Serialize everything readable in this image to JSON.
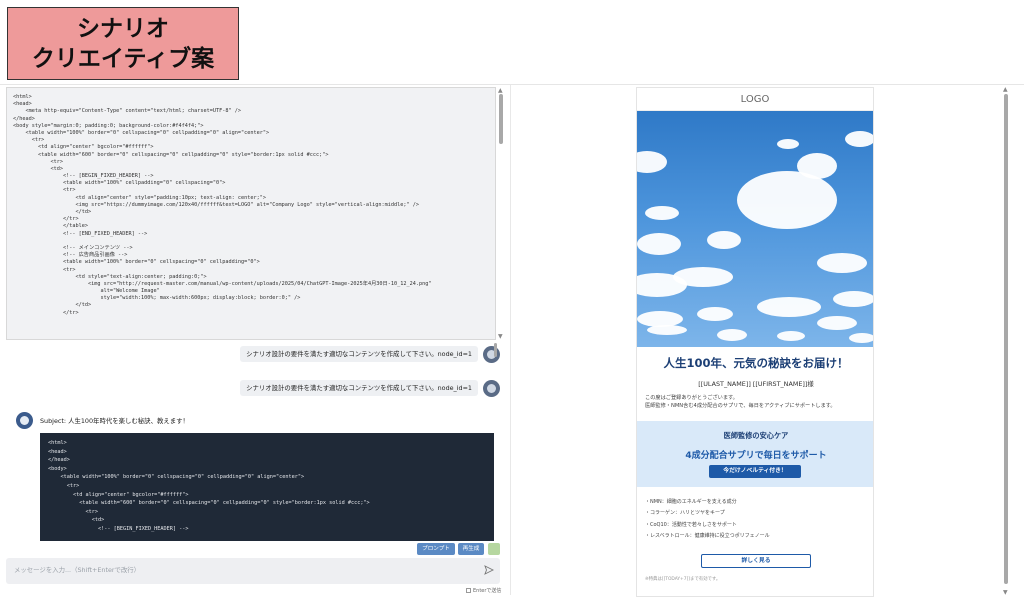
{
  "title_badge": {
    "line1": "シナリオ",
    "line2": "クリエイティブ案"
  },
  "code_viewer": {
    "lines": [
      "<html>",
      "<head>",
      "    <meta http-equiv=\"Content-Type\" content=\"text/html; charset=UTF-8\" />",
      "</head>",
      "<body style=\"margin:0; padding:0; background-color:#f4f4f4;\">",
      "    <table width=\"100%\" border=\"0\" cellspacing=\"0\" cellpadding=\"0\" align=\"center\">",
      "      <tr>",
      "        <td align=\"center\" bgcolor=\"#ffffff\">",
      "        <table width=\"600\" border=\"0\" cellspacing=\"0\" cellpadding=\"0\" style=\"border:1px solid #ccc;\">",
      "            <tr>",
      "            <td>",
      "                <!-- [BEGIN_FIXED_HEADER] -->",
      "                <table width=\"100%\" cellpadding=\"0\" cellspacing=\"0\">",
      "                <tr>",
      "                    <td align=\"center\" style=\"padding:10px; text-align: center;\">",
      "                    <img src=\"https://dummyimage.com/120x40/ffffff&text=LOGO\" alt=\"Company Logo\" style=\"vertical-align:middle;\" />",
      "                    </td>",
      "                </tr>",
      "                </table>",
      "                <!-- [END_FIXED_HEADER] -->",
      "",
      "                <!-- メインコンテンツ -->",
      "                <!-- 広告商品引画像 -->",
      "                <table width=\"100%\" border=\"0\" cellspacing=\"0\" cellpadding=\"0\">",
      "                <tr>",
      "                    <td style=\"text-align:center; padding:0;\">",
      "                        <img src=\"http://request-master.com/manual/wp-content/uploads/2025/04/ChatGPT-Image-2025年4月30日-10_12_24.png\"",
      "                            alt=\"Welcome Image\"",
      "                            style=\"width:100%; max-width:600px; display:block; border:0;\" />",
      "                    </td>",
      "                </tr>"
    ]
  },
  "chat": {
    "user_message_1": "シナリオ設計の要件を満たす適切なコンテンツを作成して下さい。node_id=1",
    "user_message_2": "シナリオ設計の要件を満たす適切なコンテンツを作成して下さい。node_id=1",
    "bot_subject": "Subject: 人生100年時代を楽しむ秘訣、教えます！",
    "bot_code_lines": [
      "<html>",
      "<head>",
      "</head>",
      "<body>",
      "    <table width=\"100%\" border=\"0\" cellspacing=\"0\" cellpadding=\"0\" align=\"center\">",
      "      <tr>",
      "        <td align=\"center\" bgcolor=\"#ffffff\">",
      "          <table width=\"600\" border=\"0\" cellspacing=\"0\" cellpadding=\"0\" style=\"border:1px solid #ccc;\">",
      "            <tr>",
      "              <td>",
      "                <!-- [BEGIN_FIXED_HEADER] -->"
    ],
    "prompt_button": "プロンプト",
    "regenerate_button": "再生成",
    "input_placeholder": "メッセージを入力...（Shift+Enterで改行）",
    "enter_toggle_label": "Enterで送信"
  },
  "email": {
    "logo": "LOGO",
    "headline": "人生100年、元気の秘訣をお届け！",
    "merge_fields": "[[ULAST_NAME]] [[UFIRST_NAME]]様",
    "intro_line1": "この度はご登録ありがとうございます。",
    "intro_line2": "医師監修・NMN含む4成分配合のサプリで、毎日をアクティブにサポートします。",
    "care_title": "医師監修の安心ケア",
    "care_sub": "4成分配合サプリで毎日をサポート",
    "care_button": "今だけノベルティ付き！",
    "features": [
      "・NMN：細胞のエネルギーを支える成分",
      "・コラーゲン：ハリとツヤをキープ",
      "・CoQ10：活動性で若々しさをサポート",
      "・レスベラトロール：健康維持に役立つポリフェノール"
    ],
    "more_button": "詳しく見る",
    "footnote": "※特典は[[TODAY+7]]まで有効です。"
  },
  "colors": {
    "title_badge_bg": "#ee9a9a",
    "accent_blue": "#1e5aa8",
    "care_bg": "#d9e9f9",
    "dark_code_bg": "#1f2937"
  }
}
